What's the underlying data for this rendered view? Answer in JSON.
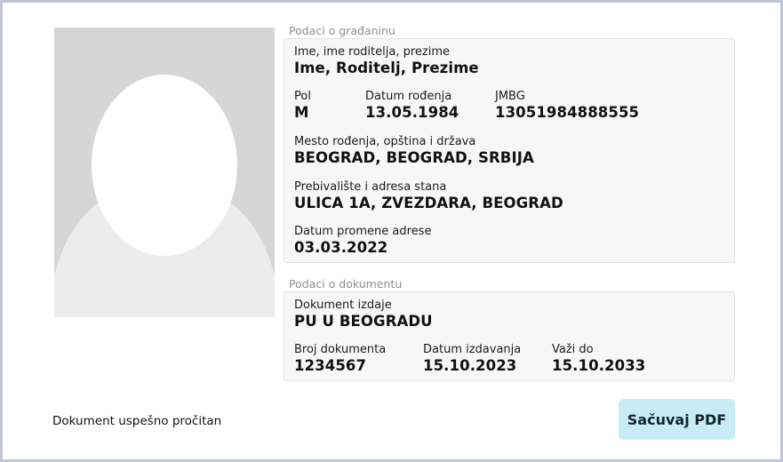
{
  "citizen_section": {
    "title": "Podaci o građaninu",
    "name": {
      "label": "Ime, ime roditelja, prezime",
      "value": "Ime, Roditelj, Prezime"
    },
    "sex": {
      "label": "Pol",
      "value": "M"
    },
    "birth_date": {
      "label": "Datum rođenja",
      "value": "13.05.1984"
    },
    "jmbg": {
      "label": "JMBG",
      "value": "13051984888555"
    },
    "birth_place": {
      "label": "Mesto rođenja, opština i država",
      "value": "BEOGRAD, BEOGRAD, SRBIJA"
    },
    "residence": {
      "label": "Prebivalište i adresa stana",
      "value": "ULICA 1A, ZVEZDARA, BEOGRAD"
    },
    "address_change_date": {
      "label": "Datum promene adrese",
      "value": "03.03.2022"
    }
  },
  "document_section": {
    "title": "Podaci o dokumentu",
    "issuer": {
      "label": "Dokument izdaje",
      "value": "PU U BEOGRADU"
    },
    "doc_number": {
      "label": "Broj dokumenta",
      "value": "1234567"
    },
    "issue_date": {
      "label": "Datum izdavanja",
      "value": "15.10.2023"
    },
    "valid_until": {
      "label": "Važi do",
      "value": "15.10.2033"
    }
  },
  "status_text": "Dokument uspešno pročitan",
  "save_button_label": "Sačuvaj PDF",
  "photo_icon": "person-placeholder-icon",
  "colors": {
    "button_bg": "#c7ecf5",
    "card_bg": "#f7f7f7",
    "frame": "#bfc5d2"
  }
}
